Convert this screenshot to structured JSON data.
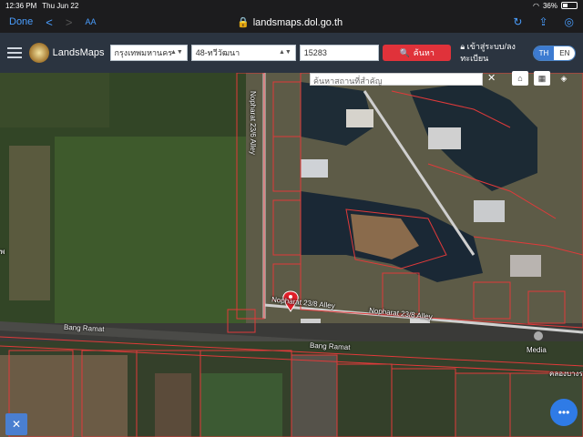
{
  "status": {
    "time": "12:36 PM",
    "date": "Thu Jun 22",
    "battery": "36%"
  },
  "browser": {
    "done": "Done",
    "back": "<",
    "forward": ">",
    "text_size": "AA",
    "url": "landsmaps.dol.go.th"
  },
  "header": {
    "brand": "LandsMaps",
    "province": "กรุงเทพมหานคร",
    "district": "48-ทวีวัฒนา",
    "parcel_no": "15283",
    "search_label": "ค้นหา",
    "login_label": "เข้าสู่ระบบ/ลงทะเบียน",
    "lang_th": "TH",
    "lang_en": "EN"
  },
  "map": {
    "place_search_placeholder": "ค้นหาสถานที่สำคัญ",
    "clear": "✕",
    "labels": {
      "nopharat_23_6": "Nopharat 23/6 Alley",
      "nopharat_23_8_left": "Nopharat 23/8 Alley",
      "nopharat_23_8_right": "Nopharat 23/8 Alley",
      "bang_ramat_left": "Bang Ramat",
      "bang_ramat_mid": "Bang Ramat",
      "media": "Media",
      "edge_text": "คลองบางรา",
      "left_edge": "พ"
    }
  }
}
